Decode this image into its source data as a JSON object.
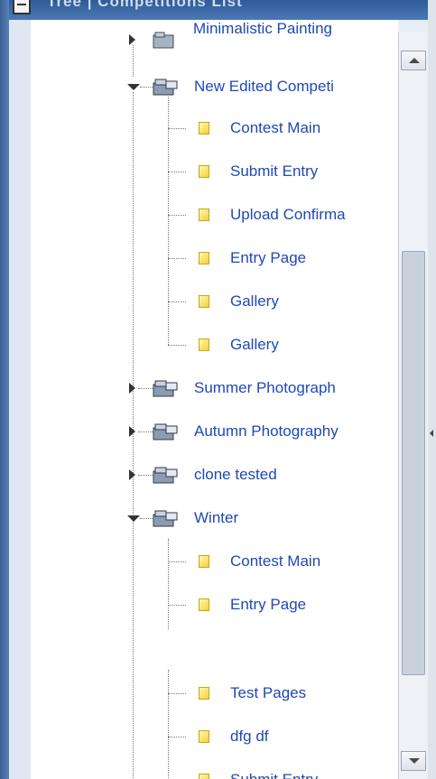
{
  "window": {
    "title": "Tree | Competitions List"
  },
  "tree": {
    "partial_top_label": "Minimalistic Painting",
    "nodes": [
      {
        "label": "New Edited Competi",
        "expanded": true
      },
      {
        "label": "Contest Main"
      },
      {
        "label": "Submit Entry"
      },
      {
        "label": "Upload Confirma"
      },
      {
        "label": "Entry Page"
      },
      {
        "label": "Gallery"
      },
      {
        "label": "Gallery"
      },
      {
        "label": "Summer Photograph",
        "expanded": false
      },
      {
        "label": "Autumn Photography",
        "expanded": false
      },
      {
        "label": "clone tested",
        "expanded": false
      },
      {
        "label": "Winter",
        "expanded": true
      },
      {
        "label": "Contest Main"
      },
      {
        "label": "Entry Page"
      },
      {
        "label": "Test Pages"
      },
      {
        "label": "dfg df"
      },
      {
        "label": "Submit Entry"
      }
    ]
  },
  "icons": {
    "folder": "competition-folder-icon",
    "page": "page-icon",
    "expand": "expand-arrow-icon",
    "collapse": "collapse-arrow-icon"
  },
  "colors": {
    "link": "#1f48b8",
    "frame": "#3a5f94"
  }
}
